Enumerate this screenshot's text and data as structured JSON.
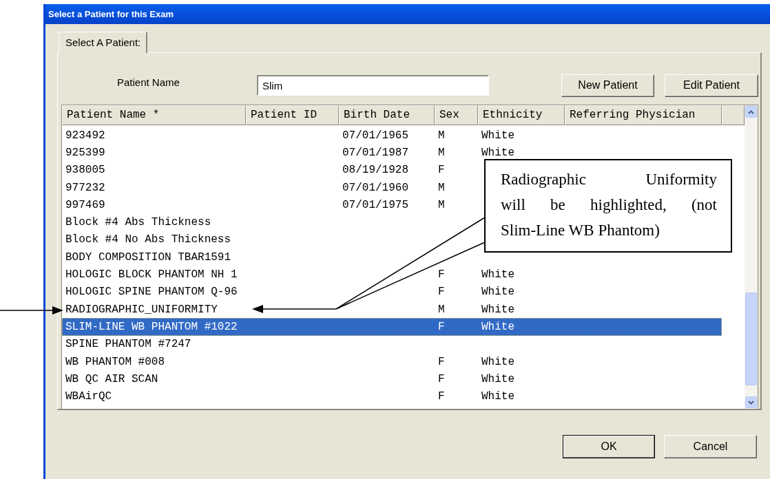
{
  "window": {
    "title": "Select a Patient for this Exam"
  },
  "tabs": [
    {
      "label": "Select A Patient:",
      "selected": true
    }
  ],
  "search": {
    "label": "Patient Name",
    "value": "Slim"
  },
  "buttons": [
    "New Patient",
    "Edit Patient"
  ],
  "table": {
    "columns": [
      "Patient Name *",
      "Patient ID",
      "Birth Date",
      "Sex",
      "Ethnicity",
      "Referring Physician"
    ],
    "rows": [
      {
        "patient_name": "923492",
        "birth_date": "07/01/1965",
        "sex": "M",
        "ethnicity": "White",
        "selected": false
      },
      {
        "patient_name": "925399",
        "birth_date": "07/01/1987",
        "sex": "M",
        "ethnicity": "White",
        "selected": false
      },
      {
        "patient_name": "938005",
        "birth_date": "08/19/1928",
        "sex": "F",
        "selected": false
      },
      {
        "patient_name": "977232",
        "birth_date": "07/01/1960",
        "sex": "M",
        "selected": false
      },
      {
        "patient_name": "997469",
        "birth_date": "07/01/1975",
        "sex": "M",
        "selected": false
      },
      {
        "patient_name": "Block #4 Abs Thickness",
        "selected": false
      },
      {
        "patient_name": "Block #4 No Abs Thickness",
        "selected": false
      },
      {
        "patient_name": "BODY COMPOSITION TBAR1591",
        "selected": false
      },
      {
        "patient_name": "HOLOGIC BLOCK PHANTOM NH 1",
        "sex": "F",
        "ethnicity": "White",
        "selected": false
      },
      {
        "patient_name": "HOLOGIC SPINE PHANTOM Q-96",
        "sex": "F",
        "ethnicity": "White",
        "selected": false
      },
      {
        "patient_name": "RADIOGRAPHIC_UNIFORMITY",
        "sex": "M",
        "ethnicity": "White",
        "selected": false
      },
      {
        "patient_name": "SLIM-LINE WB PHANTOM #1022",
        "sex": "F",
        "ethnicity": "White",
        "selected": true
      },
      {
        "patient_name": "SPINE PHANTOM #7247",
        "selected": false
      },
      {
        "patient_name": "WB PHANTOM #008",
        "sex": "F",
        "ethnicity": "White",
        "selected": false
      },
      {
        "patient_name": "WB QC AIR SCAN",
        "sex": "F",
        "ethnicity": "White",
        "selected": false
      },
      {
        "patient_name": "WBAirQC",
        "sex": "F",
        "ethnicity": "White",
        "selected": false
      }
    ]
  },
  "dialog_buttons": [
    "OK",
    "Cancel"
  ],
  "annotation": {
    "lines": [
      "Radiographic Uniformity",
      "will be highlighted, (not",
      "Slim-Line WB Phantom)"
    ]
  }
}
